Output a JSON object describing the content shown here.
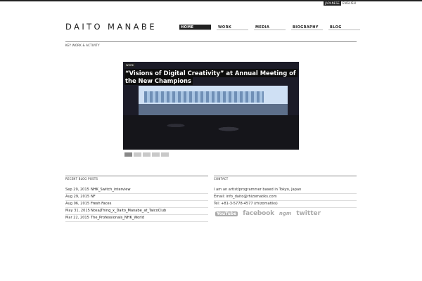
{
  "header": {
    "lang": [
      "JAPANESE",
      "ENGLISH"
    ],
    "logo": "DAITO MANABE",
    "nav": [
      "HOME",
      "WORK",
      "MEDIA",
      "BIOGRAPHY",
      "BLOG"
    ],
    "subtitle": "KEY WORK & ACTIVITY"
  },
  "hero": {
    "tag": "WORK",
    "headline": "“Visions of Digital Creativity” at Annual Meeting of the New Champions"
  },
  "blog": {
    "title": "RECENT BLOG POSTS",
    "items": [
      {
        "date": "Sep 29, 2015",
        "title": "NHK_Switch_interview"
      },
      {
        "date": "Aug 29, 2015",
        "title": "NF"
      },
      {
        "date": "Aug 06, 2015",
        "title": "Fresh Faces"
      },
      {
        "date": "May 31, 2015",
        "title": "NosajThing_x_Daito_Manabe_at_TaicoClub"
      },
      {
        "date": "Mar 22, 2015",
        "title": "The_Professionals_NHK_World"
      }
    ]
  },
  "contact": {
    "title": "CONTACT",
    "lines": [
      "I am an artist/programmer based in Tokyo, Japan",
      "Email: info_daito@rhizomatiks.com",
      "Tel: +81-3-5778-4577 (rhizomatiks)"
    ],
    "social": [
      "YouTube",
      "facebook",
      "ngm",
      "twitter"
    ]
  }
}
